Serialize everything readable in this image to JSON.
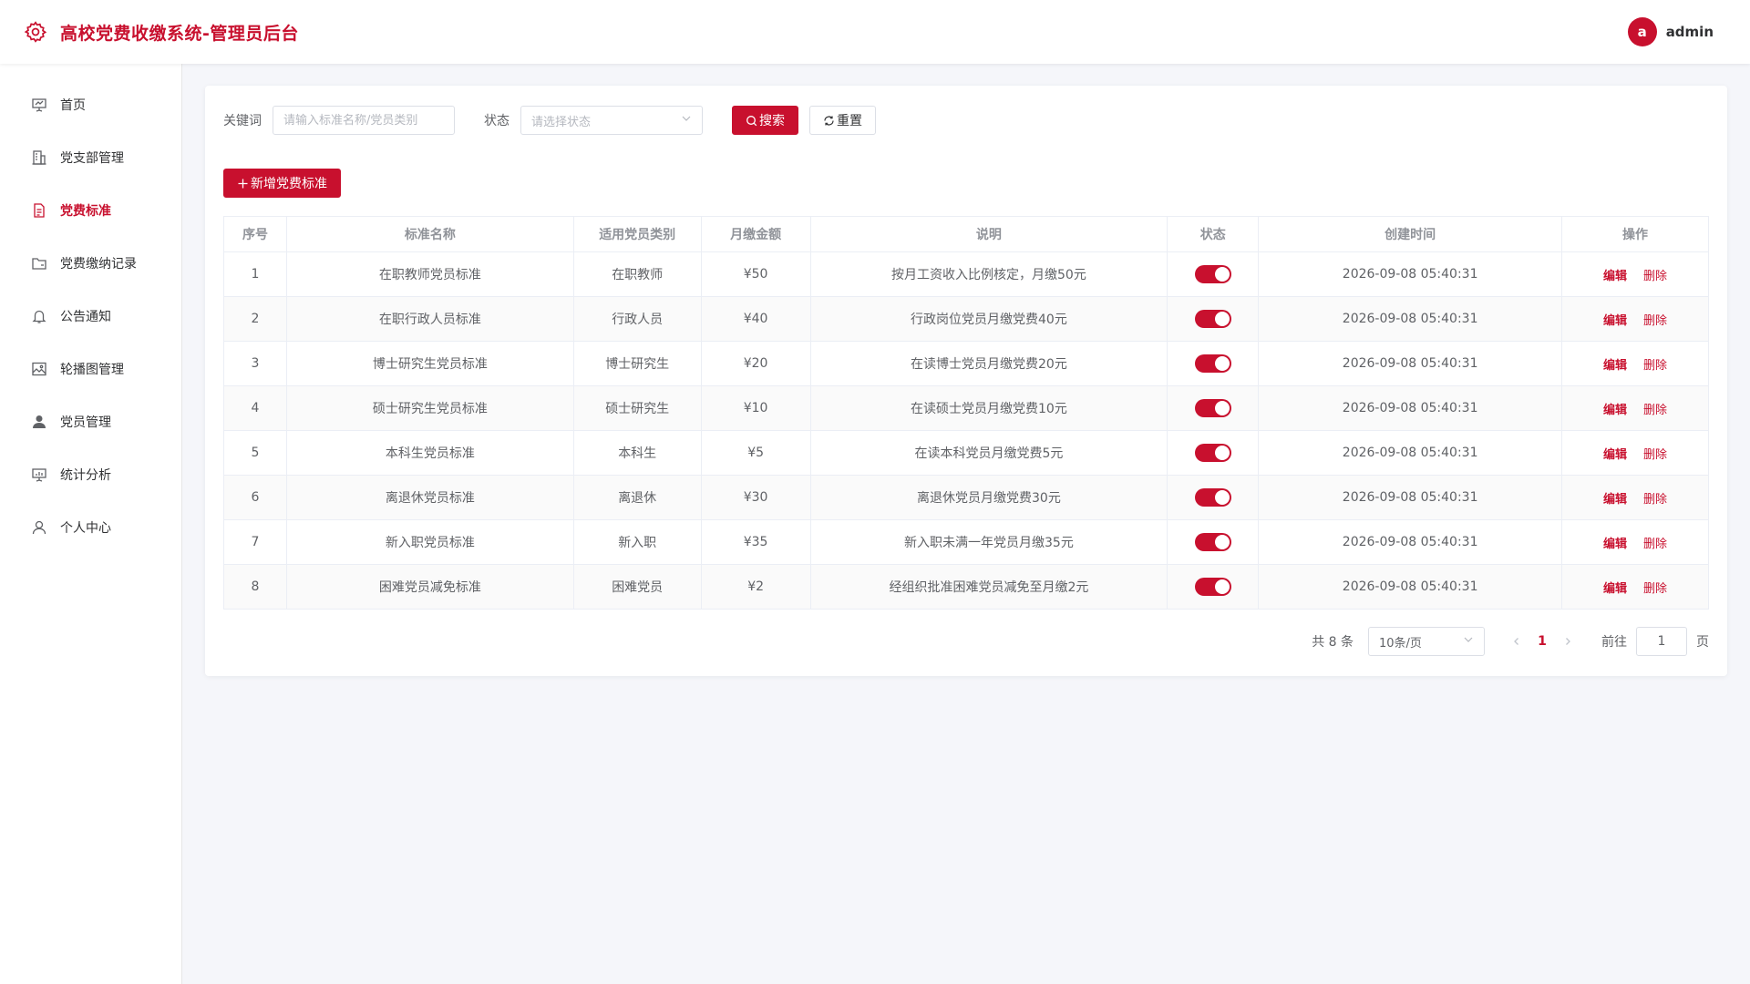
{
  "header": {
    "title": "高校党费收缴系统-管理员后台",
    "avatar_letter": "a",
    "username": "admin",
    "accent_color": "#c8102e"
  },
  "sidebar": {
    "items": [
      {
        "label": "首页",
        "icon": "presentation-icon"
      },
      {
        "label": "党支部管理",
        "icon": "building-icon"
      },
      {
        "label": "党费标准",
        "icon": "document-icon",
        "active": true
      },
      {
        "label": "党费缴纳记录",
        "icon": "folder-icon"
      },
      {
        "label": "公告通知",
        "icon": "bell-icon"
      },
      {
        "label": "轮播图管理",
        "icon": "picture-icon"
      },
      {
        "label": "党员管理",
        "icon": "user-filled-icon"
      },
      {
        "label": "统计分析",
        "icon": "chart-board-icon"
      },
      {
        "label": "个人中心",
        "icon": "user-icon"
      }
    ]
  },
  "filters": {
    "keyword_label": "关键词",
    "keyword_placeholder": "请输入标准名称/党员类别",
    "status_label": "状态",
    "status_placeholder": "请选择状态",
    "search_label": "搜索",
    "reset_label": "重置"
  },
  "add_button_label": "新增党费标准",
  "table": {
    "columns": [
      "序号",
      "标准名称",
      "适用党员类别",
      "月缴金额",
      "说明",
      "状态",
      "创建时间",
      "操作"
    ],
    "rows": [
      {
        "index": "1",
        "name": "在职教师党员标准",
        "category": "在职教师",
        "amount": "¥50",
        "desc": "按月工资收入比例核定，月缴50元",
        "enabled": true,
        "created": "2026-09-08 05:40:31"
      },
      {
        "index": "2",
        "name": "在职行政人员标准",
        "category": "行政人员",
        "amount": "¥40",
        "desc": "行政岗位党员月缴党费40元",
        "enabled": true,
        "created": "2026-09-08 05:40:31"
      },
      {
        "index": "3",
        "name": "博士研究生党员标准",
        "category": "博士研究生",
        "amount": "¥20",
        "desc": "在读博士党员月缴党费20元",
        "enabled": true,
        "created": "2026-09-08 05:40:31"
      },
      {
        "index": "4",
        "name": "硕士研究生党员标准",
        "category": "硕士研究生",
        "amount": "¥10",
        "desc": "在读硕士党员月缴党费10元",
        "enabled": true,
        "created": "2026-09-08 05:40:31"
      },
      {
        "index": "5",
        "name": "本科生党员标准",
        "category": "本科生",
        "amount": "¥5",
        "desc": "在读本科党员月缴党费5元",
        "enabled": true,
        "created": "2026-09-08 05:40:31"
      },
      {
        "index": "6",
        "name": "离退休党员标准",
        "category": "离退休",
        "amount": "¥30",
        "desc": "离退休党员月缴党费30元",
        "enabled": true,
        "created": "2026-09-08 05:40:31"
      },
      {
        "index": "7",
        "name": "新入职党员标准",
        "category": "新入职",
        "amount": "¥35",
        "desc": "新入职未满一年党员月缴35元",
        "enabled": true,
        "created": "2026-09-08 05:40:31"
      },
      {
        "index": "8",
        "name": "困难党员减免标准",
        "category": "困难党员",
        "amount": "¥2",
        "desc": "经组织批准困难党员减免至月缴2元",
        "enabled": true,
        "created": "2026-09-08 05:40:31"
      }
    ],
    "edit_label": "编辑",
    "delete_label": "删除"
  },
  "pagination": {
    "total_text": "共 8 条",
    "page_size": "10条/页",
    "current_page": "1",
    "goto_label": "前往",
    "goto_value": "1",
    "page_suffix": "页"
  }
}
